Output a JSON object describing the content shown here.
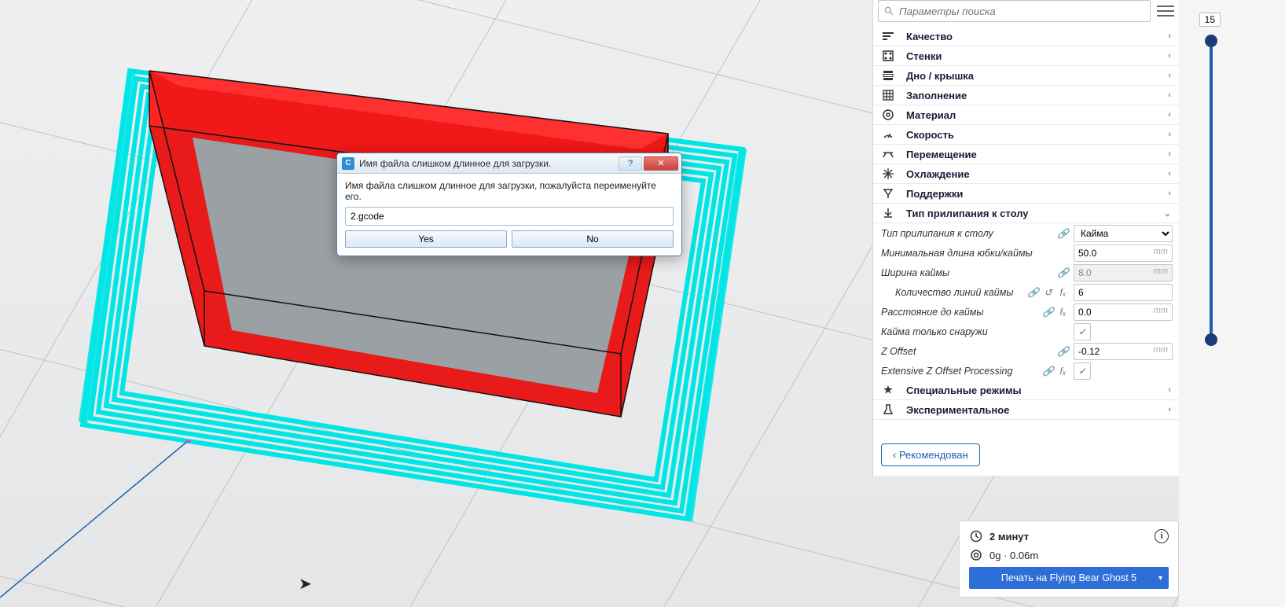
{
  "search": {
    "placeholder": "Параметры поиска"
  },
  "categories": [
    {
      "label": "Качество",
      "icon": "quality"
    },
    {
      "label": "Стенки",
      "icon": "walls"
    },
    {
      "label": "Дно / крышка",
      "icon": "topbottom"
    },
    {
      "label": "Заполнение",
      "icon": "infill"
    },
    {
      "label": "Материал",
      "icon": "material"
    },
    {
      "label": "Скорость",
      "icon": "speed"
    },
    {
      "label": "Перемещение",
      "icon": "travel"
    },
    {
      "label": "Охлаждение",
      "icon": "cooling"
    },
    {
      "label": "Поддержки",
      "icon": "support"
    },
    {
      "label": "Тип прилипания к столу",
      "icon": "adhesion",
      "expanded": true
    },
    {
      "label": "Специальные режимы",
      "icon": "special"
    },
    {
      "label": "Экспериментальное",
      "icon": "experimental"
    }
  ],
  "adhesion": {
    "type_label": "Тип прилипания к столу",
    "type_value": "Кайма",
    "min_len_label": "Минимальная длина юбки/каймы",
    "min_len_value": "50.0",
    "width_label": "Ширина каймы",
    "width_value": "8.0",
    "lines_label": "Количество линий каймы",
    "lines_value": "6",
    "dist_label": "Расстояние до каймы",
    "dist_value": "0.0",
    "outside_label": "Кайма только снаружи",
    "outside_value": true,
    "zoff_label": "Z Offset",
    "zoff_value": "-0.12",
    "ext_label": "Extensive Z Offset Processing",
    "ext_value": true,
    "unit_mm": "mm"
  },
  "recommend_label": "Рекомендован",
  "slider": {
    "value": "15"
  },
  "info": {
    "time": "2 минут",
    "mass": "0g · 0.06m",
    "print_label": "Печать на Flying Bear Ghost 5"
  },
  "dialog": {
    "title": "Имя файла слишком длинное для загрузки.",
    "message": "Имя файла слишком длинное для загрузки, пожалуйста переименуйте его.",
    "filename": "2.gcode",
    "yes": "Yes",
    "no": "No",
    "help": "?",
    "close": "✕"
  }
}
